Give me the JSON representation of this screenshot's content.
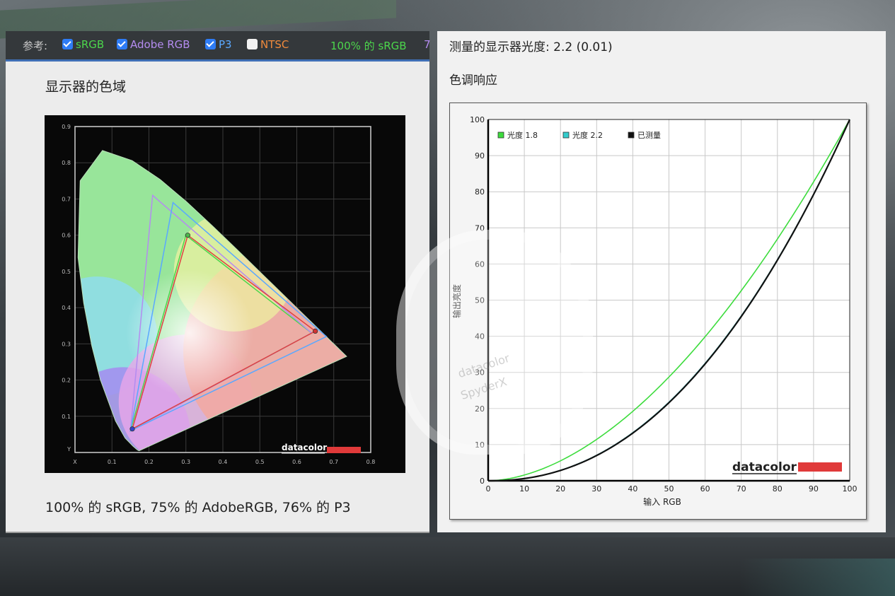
{
  "reference_bar": {
    "label": "参考:",
    "options": [
      {
        "name": "sRGB",
        "checked": true,
        "color": "#4cd64c"
      },
      {
        "name": "Adobe RGB",
        "checked": true,
        "color": "#b48cf0"
      },
      {
        "name": "P3",
        "checked": true,
        "color": "#5aa8ff"
      },
      {
        "name": "NTSC",
        "checked": false,
        "color": "#f08a3c"
      }
    ],
    "coverage_text": "100% 的 sRGB",
    "coverage_cut": "7"
  },
  "gamut_panel": {
    "title": "显示器的色域",
    "caption": "100% 的 sRGB, 75% 的 AdobeRGB, 76% 的 P3",
    "brand": "datacolor"
  },
  "gamma_panel": {
    "measured_gamma": "测量的显示器光度: 2.2 (0.01)",
    "tone_title": "色调响应",
    "brand": "datacolor"
  },
  "overlay": {
    "brand": "datacolor",
    "model": "SpyderX"
  },
  "chart_data": [
    {
      "type": "scatter",
      "name": "gamut",
      "xlabel": "X",
      "ylabel": "Y",
      "xlim": [
        0,
        0.8
      ],
      "ylim": [
        0,
        0.9
      ],
      "x_ticks": [
        "0.1",
        "0.2",
        "0.3",
        "0.4",
        "0.5",
        "0.6",
        "0.7",
        "0.8"
      ],
      "y_ticks": [
        "0.1",
        "0.2",
        "0.3",
        "0.4",
        "0.5",
        "0.6",
        "0.7",
        "0.8",
        "0.9"
      ],
      "triangles": [
        {
          "label": "sRGB",
          "color": "#4cd64c",
          "points": [
            [
              0.64,
              0.33
            ],
            [
              0.3,
              0.6
            ],
            [
              0.15,
              0.06
            ]
          ]
        },
        {
          "label": "Adobe RGB",
          "color": "#b48cf0",
          "points": [
            [
              0.64,
              0.33
            ],
            [
              0.21,
              0.71
            ],
            [
              0.15,
              0.06
            ]
          ]
        },
        {
          "label": "P3",
          "color": "#5aa8ff",
          "points": [
            [
              0.68,
              0.32
            ],
            [
              0.265,
              0.69
            ],
            [
              0.15,
              0.06
            ]
          ]
        },
        {
          "label": "measured",
          "color": "#e04040",
          "points": [
            [
              0.65,
              0.335
            ],
            [
              0.305,
              0.6
            ],
            [
              0.155,
              0.065
            ]
          ]
        }
      ],
      "locus": [
        [
          0.1741,
          0.005
        ],
        [
          0.1738,
          0.0049
        ],
        [
          0.1726,
          0.0048
        ],
        [
          0.1689,
          0.0069
        ],
        [
          0.1566,
          0.0177
        ],
        [
          0.1355,
          0.0399
        ],
        [
          0.1096,
          0.0868
        ],
        [
          0.0687,
          0.2007
        ],
        [
          0.0454,
          0.295
        ],
        [
          0.0235,
          0.4127
        ],
        [
          0.0082,
          0.5384
        ],
        [
          0.0139,
          0.7502
        ],
        [
          0.0743,
          0.8338
        ],
        [
          0.1547,
          0.8059
        ],
        [
          0.2296,
          0.7543
        ],
        [
          0.3016,
          0.6923
        ],
        [
          0.3731,
          0.6245
        ],
        [
          0.4441,
          0.5547
        ],
        [
          0.5125,
          0.4866
        ],
        [
          0.5752,
          0.4242
        ],
        [
          0.627,
          0.3725
        ],
        [
          0.6658,
          0.334
        ],
        [
          0.6915,
          0.3083
        ],
        [
          0.7079,
          0.292
        ],
        [
          0.719,
          0.2809
        ],
        [
          0.7347,
          0.2653
        ],
        [
          0.1741,
          0.005
        ]
      ]
    },
    {
      "type": "line",
      "name": "tone_response",
      "xlabel": "输入 RGB",
      "ylabel": "输出亮度",
      "xlim": [
        0,
        100
      ],
      "ylim": [
        0,
        100
      ],
      "x_ticks": [
        "0",
        "10",
        "20",
        "30",
        "40",
        "50",
        "60",
        "70",
        "80",
        "90",
        "100"
      ],
      "y_ticks": [
        "0",
        "10",
        "20",
        "30",
        "40",
        "50",
        "60",
        "70",
        "80",
        "90",
        "100"
      ],
      "series": [
        {
          "name": "光度 1.8",
          "color": "#3ddc3d",
          "gamma": 1.8
        },
        {
          "name": "光度 2.2",
          "color": "#33cccc",
          "gamma": 2.2
        },
        {
          "name": "已测量",
          "color": "#111111",
          "gamma": 2.21
        }
      ]
    }
  ]
}
